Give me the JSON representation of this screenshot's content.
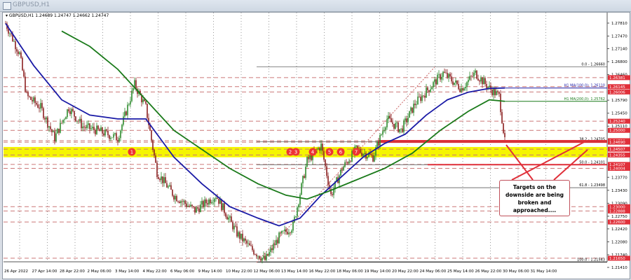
{
  "window": {
    "title": "GBPUSD,H1"
  },
  "legend": {
    "symbol": "GBPUSD,H1",
    "ohlc": "1.24689 1.24747 1.24662 1.24747"
  },
  "annotation": {
    "text": "Targets on the downside are being broken and approached...."
  },
  "colors": {
    "ma100": "#1a1aa6",
    "ma200": "#1a7a1a",
    "level": "#e0303a",
    "zone": "#f5f500",
    "bull": "#2e8b2e",
    "bear": "#8b2020"
  },
  "chart_data": {
    "type": "line",
    "title": "GBPUSD,H1",
    "ylim": [
      1.2141,
      1.2781
    ],
    "x_ticks": [
      "26 Apr 2022",
      "27 Apr 14:00",
      "28 Apr 22:00",
      "2 May 06:00",
      "3 May 14:00",
      "4 May 22:00",
      "6 May 06:00",
      "9 May 14:00",
      "10 May 22:00",
      "12 May 06:00",
      "13 May 14:00",
      "16 May 22:00",
      "18 May 06:00",
      "19 May 14:00",
      "20 May 22:00",
      "24 May 06:00",
      "25 May 14:00",
      "26 May 22:00",
      "30 May 06:00",
      "31 May 14:00"
    ],
    "y_ticks": [
      "1.27810",
      "1.27470",
      "1.27140",
      "1.26800",
      "1.26460",
      "1.25790",
      "1.25450",
      "1.25110",
      "1.23770",
      "1.23430",
      "1.23090",
      "1.22750",
      "1.22420",
      "1.22080",
      "1.21740",
      "1.21410"
    ],
    "price_path": [
      [
        0,
        1.278
      ],
      [
        10,
        1.27
      ],
      [
        15,
        1.259
      ],
      [
        25,
        1.256
      ],
      [
        35,
        1.248
      ],
      [
        45,
        1.256
      ],
      [
        55,
        1.251
      ],
      [
        65,
        1.25
      ],
      [
        80,
        1.248
      ],
      [
        92,
        1.262
      ],
      [
        100,
        1.256
      ],
      [
        108,
        1.239
      ],
      [
        120,
        1.233
      ],
      [
        135,
        1.229
      ],
      [
        150,
        1.233
      ],
      [
        165,
        1.223
      ],
      [
        175,
        1.219
      ],
      [
        185,
        1.216
      ],
      [
        195,
        1.222
      ],
      [
        205,
        1.225
      ],
      [
        215,
        1.242
      ],
      [
        225,
        1.246
      ],
      [
        232,
        1.233
      ],
      [
        240,
        1.24
      ],
      [
        250,
        1.245
      ],
      [
        262,
        1.243
      ],
      [
        272,
        1.253
      ],
      [
        282,
        1.25
      ],
      [
        292,
        1.257
      ],
      [
        302,
        1.261
      ],
      [
        312,
        1.265
      ],
      [
        325,
        1.261
      ],
      [
        335,
        1.265
      ],
      [
        345,
        1.261
      ],
      [
        352,
        1.259
      ],
      [
        356,
        1.247
      ]
    ],
    "series": [
      {
        "name": "H1 MA(100,0)",
        "label": "H1 MA(100,0): 1.26110",
        "points": [
          [
            0,
            1.278
          ],
          [
            20,
            1.267
          ],
          [
            40,
            1.258
          ],
          [
            60,
            1.254
          ],
          [
            80,
            1.253
          ],
          [
            100,
            1.253
          ],
          [
            120,
            1.243
          ],
          [
            140,
            1.236
          ],
          [
            160,
            1.23
          ],
          [
            180,
            1.227
          ],
          [
            195,
            1.225
          ],
          [
            210,
            1.227
          ],
          [
            225,
            1.233
          ],
          [
            240,
            1.238
          ],
          [
            255,
            1.243
          ],
          [
            270,
            1.2465
          ],
          [
            285,
            1.249
          ],
          [
            300,
            1.254
          ],
          [
            315,
            1.258
          ],
          [
            330,
            1.26
          ],
          [
            345,
            1.261
          ],
          [
            356,
            1.2611
          ]
        ]
      },
      {
        "name": "H1 MA(200,0)",
        "label": "H1 MA(200,0): 1.25762",
        "points": [
          [
            40,
            1.276
          ],
          [
            60,
            1.272
          ],
          [
            80,
            1.266
          ],
          [
            100,
            1.258
          ],
          [
            120,
            1.25
          ],
          [
            140,
            1.245
          ],
          [
            160,
            1.24
          ],
          [
            180,
            1.236
          ],
          [
            200,
            1.233
          ],
          [
            215,
            1.232
          ],
          [
            230,
            1.234
          ],
          [
            250,
            1.237
          ],
          [
            270,
            1.24
          ],
          [
            290,
            1.244
          ],
          [
            310,
            1.25
          ],
          [
            330,
            1.255
          ],
          [
            345,
            1.258
          ],
          [
            356,
            1.2576
          ]
        ]
      }
    ],
    "price_labels": [
      "1.26381",
      "1.26145",
      "1.26006",
      "1.25240",
      "1.25000",
      "1.24730",
      "1.24690",
      "1.24507",
      "1.24355",
      "1.24107",
      "1.24004",
      "1.23000",
      "1.22888",
      "1.22600",
      "1.21650"
    ],
    "fib_levels": [
      {
        "pct": "0.0",
        "price": 1.2666,
        "label": "0.0 - 1.26660"
      },
      {
        "pct": "38.2",
        "price": 1.24705,
        "label": "38.2 - 1.24705"
      },
      {
        "pct": "50.0",
        "price": 1.24101,
        "label": "50.0 - 1.24101"
      },
      {
        "pct": "61.8",
        "price": 1.23498,
        "label": "61.8 - 1.23498"
      },
      {
        "pct": "100.0",
        "price": 1.21543,
        "label": "100.0 - 1.21543"
      }
    ],
    "support_zone": [
      1.2435,
      1.2451
    ],
    "markers": [
      {
        "label": "1",
        "bar": 90
      },
      {
        "label": "2",
        "bar": 203
      },
      {
        "label": "3",
        "bar": 207
      },
      {
        "label": "4",
        "bar": 219
      },
      {
        "label": "5",
        "bar": 231
      },
      {
        "label": "6",
        "bar": 239
      },
      {
        "label": "7",
        "bar": 250
      }
    ]
  }
}
